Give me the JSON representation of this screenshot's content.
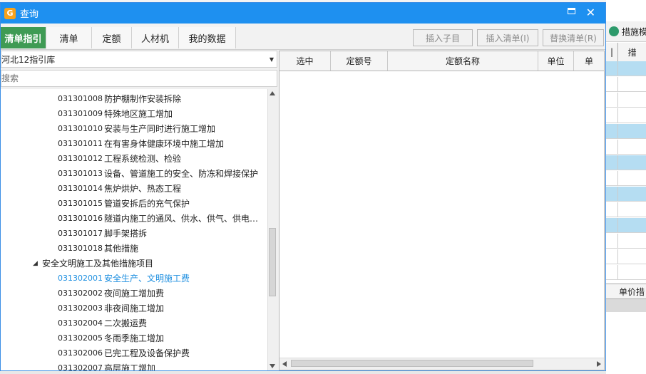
{
  "dialog": {
    "title": "查询"
  },
  "tabs": [
    {
      "label": "清单指引",
      "active": true
    },
    {
      "label": "清单",
      "active": false
    },
    {
      "label": "定额",
      "active": false
    },
    {
      "label": "人材机",
      "active": false
    },
    {
      "label": "我的数据",
      "active": false
    }
  ],
  "toolbar": {
    "insert_child": "插入子目",
    "insert_list": "插入清单(I)",
    "replace_list": "替换清单(R)"
  },
  "library": {
    "selected": "河北12指引库"
  },
  "search": {
    "placeholder": "搜索"
  },
  "tree": {
    "items": [
      {
        "code": "031301008",
        "name": "防护棚制作安装拆除"
      },
      {
        "code": "031301009",
        "name": "特殊地区施工增加"
      },
      {
        "code": "031301010",
        "name": "安装与生产同时进行施工增加"
      },
      {
        "code": "031301011",
        "name": "在有害身体健康环境中施工增加"
      },
      {
        "code": "031301012",
        "name": "工程系统检测、检验"
      },
      {
        "code": "031301013",
        "name": "设备、管道施工的安全、防冻和焊接保护"
      },
      {
        "code": "031301014",
        "name": "焦炉烘炉、热态工程"
      },
      {
        "code": "031301015",
        "name": "管道安拆后的充气保护"
      },
      {
        "code": "031301016",
        "name": "隧道内施工的通风、供水、供气、供电…"
      },
      {
        "code": "031301017",
        "name": "脚手架搭拆"
      },
      {
        "code": "031301018",
        "name": "其他措施"
      }
    ],
    "group": "安全文明施工及其他措施项目",
    "group_items": [
      {
        "code": "031302001",
        "name": "安全生产、文明施工费",
        "selected": true
      },
      {
        "code": "031302002",
        "name": "夜间施工增加费"
      },
      {
        "code": "031302003",
        "name": "非夜间施工增加"
      },
      {
        "code": "031302004",
        "name": "二次搬运费"
      },
      {
        "code": "031302005",
        "name": "冬雨季施工增加"
      },
      {
        "code": "031302006",
        "name": "已完工程及设备保护费"
      },
      {
        "code": "031302007",
        "name": "高层施工增加"
      }
    ]
  },
  "grid": {
    "columns": [
      "选中",
      "定额号",
      "定额名称",
      "单位",
      "单"
    ]
  },
  "background": {
    "panel_title": "措施模",
    "header_col1": "|",
    "header_col2": "措",
    "footer": "单价措"
  }
}
